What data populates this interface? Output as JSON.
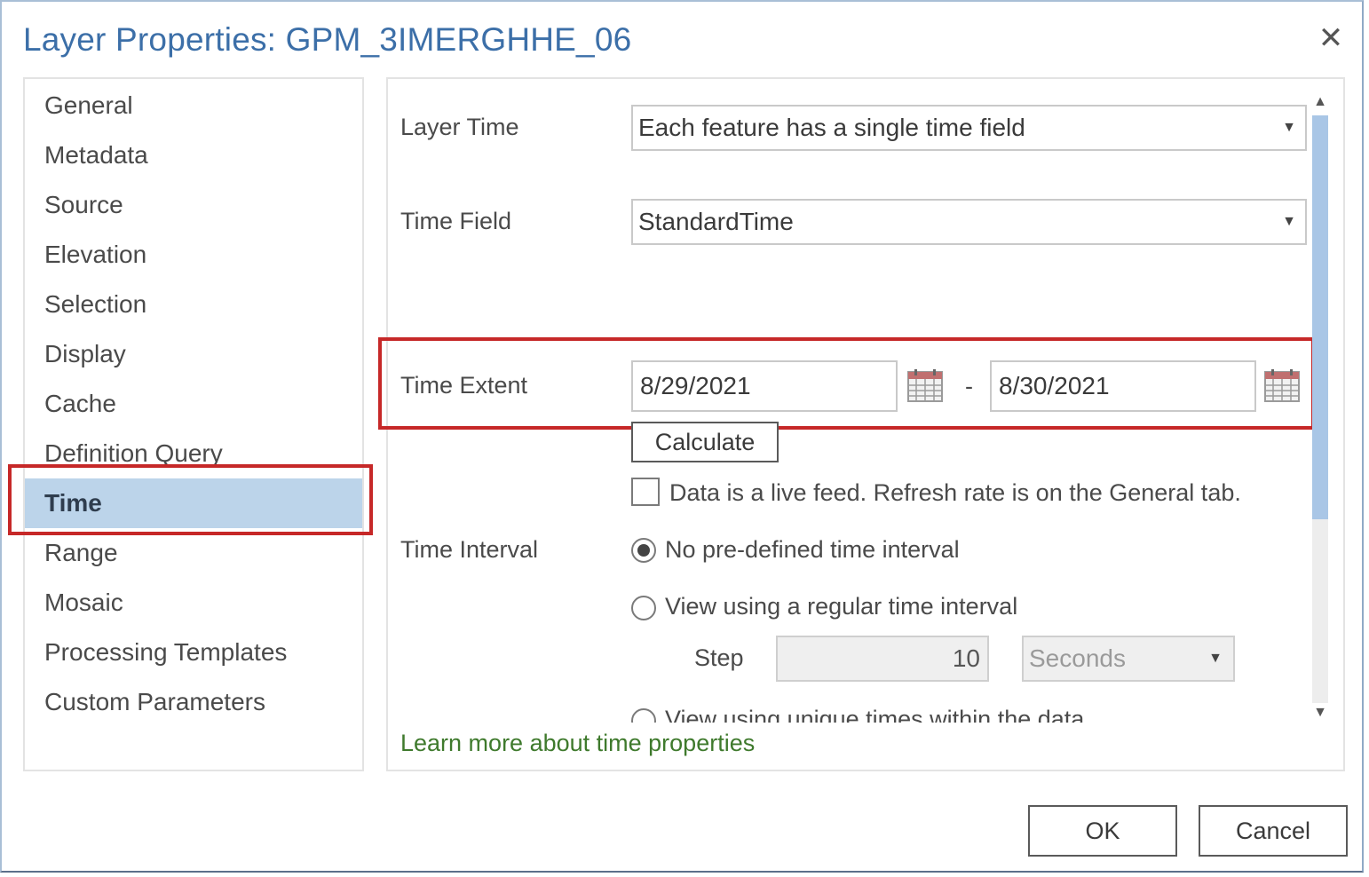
{
  "window": {
    "title": "Layer Properties: GPM_3IMERGHHE_06",
    "close_label": "✕"
  },
  "nav": {
    "items": [
      {
        "label": "General"
      },
      {
        "label": "Metadata"
      },
      {
        "label": "Source"
      },
      {
        "label": "Elevation"
      },
      {
        "label": "Selection"
      },
      {
        "label": "Display"
      },
      {
        "label": "Cache"
      },
      {
        "label": "Definition Query"
      },
      {
        "label": "Time"
      },
      {
        "label": "Range"
      },
      {
        "label": "Mosaic"
      },
      {
        "label": "Processing Templates"
      },
      {
        "label": "Custom Parameters"
      }
    ],
    "selected": "Time"
  },
  "time": {
    "layer_time_label": "Layer Time",
    "layer_time_value": "Each feature has a single time field",
    "time_field_label": "Time Field",
    "time_field_value": "StandardTime",
    "extent_label": "Time Extent",
    "start_date": "8/29/2021",
    "separator": "-",
    "end_date": "8/30/2021",
    "calculate_label": "Calculate",
    "live_feed_label": "Data is a live feed. Refresh rate is on the General tab.",
    "live_feed_checked": false,
    "interval_label": "Time Interval",
    "radio_no_interval": "No pre-defined time interval",
    "radio_regular": "View using a regular time interval",
    "radio_unique": "View using unique times within the data",
    "step_label": "Step",
    "step_value": "10",
    "step_unit": "Seconds",
    "learn_more": "Learn more about time properties"
  },
  "buttons": {
    "ok": "OK",
    "cancel": "Cancel"
  },
  "colors": {
    "title": "#3c6fa8",
    "selected_nav": "#bcd4ea",
    "highlight": "#c62828",
    "link": "#3f7a2d"
  }
}
